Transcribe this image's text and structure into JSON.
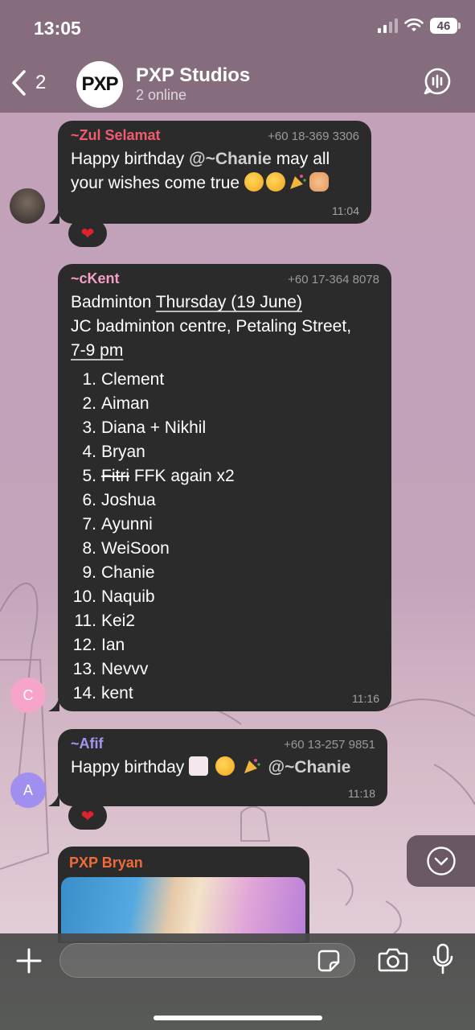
{
  "status_bar": {
    "time": "13:05",
    "battery": "46"
  },
  "header": {
    "back_count": "2",
    "group_avatar_text": "PXP",
    "group_name": "PXP Studios",
    "subtitle": "2 online"
  },
  "messages": [
    {
      "sender": "~Zul Selamat",
      "sender_color": "#f25c6e",
      "phone": "+60 18-369 3306",
      "text_before": "Happy birthday ",
      "mention": "@~Chanie",
      "text_after": " may all your wishes come true",
      "time": "11:04",
      "reaction": "❤"
    },
    {
      "sender": "~cKent",
      "sender_color": "#f2a0c7",
      "phone": "+60 17-364 8078",
      "line1_plain": "Badminton ",
      "line1_link": "Thursday (19 June)",
      "line2": "JC badminton centre, Petaling Street,",
      "line3_link": "7-9 pm",
      "list": [
        {
          "num": "1.",
          "text": "Clement"
        },
        {
          "num": "2.",
          "text": "Aiman"
        },
        {
          "num": "3.",
          "text": "Diana + Nikhil"
        },
        {
          "num": "4.",
          "text": "Bryan"
        },
        {
          "num": "5.",
          "strike": "Fitri",
          "text": " FFK again x2"
        },
        {
          "num": "6.",
          "text": "Joshua"
        },
        {
          "num": "7.",
          "text": "Ayunni"
        },
        {
          "num": "8.",
          "text": "WeiSoon"
        },
        {
          "num": "9.",
          "text": "Chanie"
        },
        {
          "num": "10.",
          "text": "Naquib"
        },
        {
          "num": "11.",
          "text": "Kei2"
        },
        {
          "num": "12.",
          "text": "Ian"
        },
        {
          "num": "13.",
          "text": "Nevvv"
        },
        {
          "num": "14.",
          "text": "kent"
        }
      ],
      "time": "11:16",
      "avatar_letter": "C",
      "avatar_color": "#f6a5c8"
    },
    {
      "sender": "~Afif",
      "sender_color": "#a695f2",
      "phone": "+60 13-257 9851",
      "text_before": "Happy birthday ",
      "mention": "@~Chanie",
      "time": "11:18",
      "reaction": "❤",
      "avatar_letter": "A",
      "avatar_color": "#a18ff0"
    },
    {
      "sender": "PXP Bryan",
      "sender_color": "#f06a3a"
    }
  ],
  "input": {
    "placeholder": ""
  },
  "icons": [
    "back-chevron-icon",
    "voice-chat-icon",
    "scroll-down-icon",
    "plus-icon",
    "sticker-icon",
    "camera-icon",
    "microphone-icon"
  ]
}
